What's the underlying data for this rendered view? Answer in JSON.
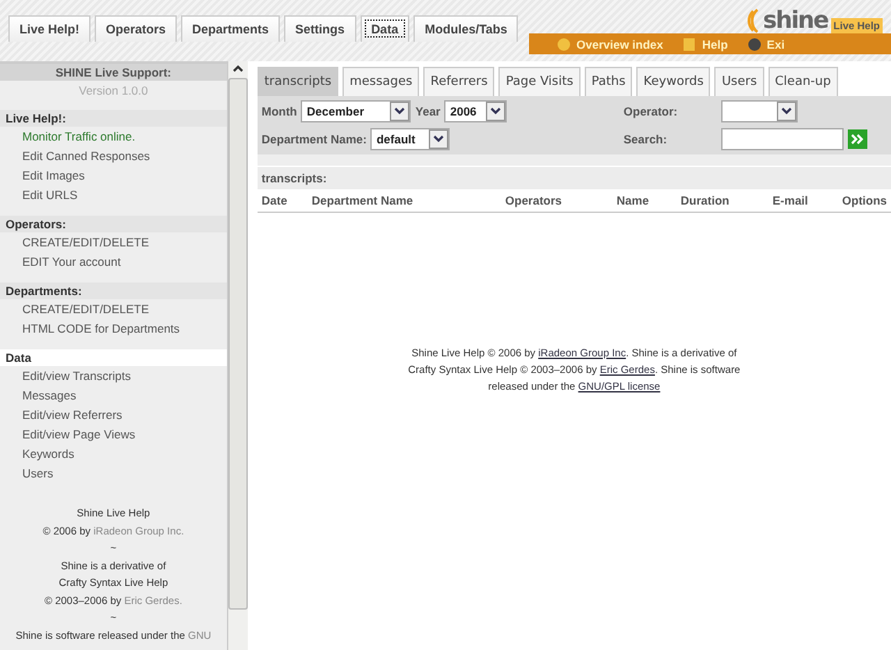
{
  "top_tabs": [
    {
      "label": "Live Help!",
      "focused": false
    },
    {
      "label": "Operators",
      "focused": false
    },
    {
      "label": "Departments",
      "focused": false
    },
    {
      "label": "Settings",
      "focused": false
    },
    {
      "label": "Data",
      "focused": true
    },
    {
      "label": "Modules/Tabs",
      "focused": false
    }
  ],
  "logo": {
    "word": "shine",
    "tagline": "Live Help"
  },
  "nav_bar": [
    "Overview index",
    "Help",
    "Exi"
  ],
  "sidebar": {
    "title": "SHINE Live Support:",
    "version": "Version 1.0.0",
    "sections": [
      {
        "heading": "Live Help!:",
        "selected": false,
        "items": [
          {
            "label": "Monitor Traffic online.",
            "selected": true
          },
          {
            "label": "Edit Canned Responses",
            "selected": false
          },
          {
            "label": "Edit Images",
            "selected": false
          },
          {
            "label": "Edit URLS",
            "selected": false
          }
        ]
      },
      {
        "heading": "Operators:",
        "selected": false,
        "items": [
          {
            "label": "CREATE/EDIT/DELETE",
            "selected": false
          },
          {
            "label": "EDIT Your account",
            "selected": false
          }
        ]
      },
      {
        "heading": "Departments:",
        "selected": false,
        "items": [
          {
            "label": "CREATE/EDIT/DELETE",
            "selected": false
          },
          {
            "label": "HTML CODE for Departments",
            "selected": false
          }
        ]
      },
      {
        "heading": "Data",
        "selected": true,
        "items": [
          {
            "label": "Edit/view Transcripts",
            "selected": false
          },
          {
            "label": "Messages",
            "selected": false
          },
          {
            "label": "Edit/view Referrers",
            "selected": false
          },
          {
            "label": "Edit/view Page Views",
            "selected": false
          },
          {
            "label": "Keywords",
            "selected": false
          },
          {
            "label": "Users",
            "selected": false
          }
        ]
      }
    ],
    "credits": [
      [
        {
          "kind": "text",
          "text": "Shine Live Help"
        }
      ],
      [
        {
          "kind": "text",
          "text": "© 2006 by "
        },
        {
          "kind": "link",
          "text": "iRadeon Group Inc."
        }
      ],
      [
        {
          "kind": "text",
          "text": "~"
        }
      ],
      [
        {
          "kind": "text",
          "text": "Shine is a derivative of"
        }
      ],
      [
        {
          "kind": "text",
          "text": "Crafty Syntax Live Help"
        }
      ],
      [
        {
          "kind": "text",
          "text": "© 2003–2006 by "
        },
        {
          "kind": "link",
          "text": "Eric Gerdes."
        }
      ],
      [
        {
          "kind": "text",
          "text": "~"
        }
      ],
      [
        {
          "kind": "text",
          "text": "Shine is software released under the "
        },
        {
          "kind": "link",
          "text": "GNU"
        }
      ]
    ]
  },
  "tabs": [
    {
      "label": "transcripts",
      "selected": true
    },
    {
      "label": "messages",
      "selected": false
    },
    {
      "label": "Referrers",
      "selected": false
    },
    {
      "label": "Page Visits",
      "selected": false
    },
    {
      "label": "Paths",
      "selected": false
    },
    {
      "label": "Keywords",
      "selected": false
    },
    {
      "label": "Users",
      "selected": false
    },
    {
      "label": "Clean-up",
      "selected": false
    }
  ],
  "filters": {
    "month": {
      "label": "Month",
      "value": "December"
    },
    "year": {
      "label": "Year",
      "value": "2006"
    },
    "department": {
      "label": "Department Name:",
      "value": "default"
    },
    "operator": {
      "label": "Operator:"
    },
    "search": {
      "label": "Search:"
    }
  },
  "table": {
    "title": "transcripts:",
    "columns": [
      "Date",
      "Department Name",
      "Operators",
      "Name",
      "Duration",
      "E-mail",
      "Options"
    ]
  },
  "footer": [
    {
      "kind": "text",
      "text": "Shine Live Help © 2006 by "
    },
    {
      "kind": "link",
      "text": "iRadeon Group Inc"
    },
    {
      "kind": "text",
      "text": ". Shine is a derivative of Crafty Syntax Live Help © 2003–2006 by "
    },
    {
      "kind": "link",
      "text": "Eric Gerdes"
    },
    {
      "kind": "text",
      "text": ". Shine is software released under the "
    },
    {
      "kind": "link",
      "text": "GNU/GPL license"
    }
  ]
}
